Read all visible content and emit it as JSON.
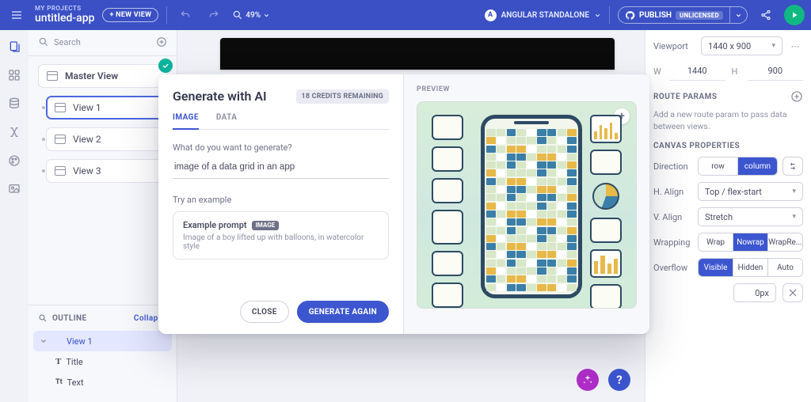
{
  "header": {
    "breadcrumb_top": "MY PROJECTS",
    "breadcrumb_title": "untitled-app",
    "new_view_btn": "+ NEW VIEW",
    "zoom_label": "49%",
    "framework_label": "ANGULAR STANDALONE",
    "publish_label": "PUBLISH",
    "license_badge": "UNLICENSED"
  },
  "left_panel": {
    "search_placeholder": "Search",
    "master_view": "Master View",
    "views": [
      "View 1",
      "View 2",
      "View 3"
    ],
    "outline_label": "OUTLINE",
    "collapse_label": "Collapse",
    "outline_tree": {
      "root": "View 1",
      "children": [
        "Title",
        "Text"
      ]
    }
  },
  "right_panel": {
    "viewport_label": "Viewport",
    "viewport_value": "1440 x 900",
    "w_label": "W",
    "w_value": "1440",
    "h_label": "H",
    "h_value": "900",
    "route_heading": "ROUTE PARAMS",
    "route_hint": "Add a new route param to pass data between views.",
    "canvas_heading": "CANVAS PROPERTIES",
    "labels": {
      "direction": "Direction",
      "h_align": "H. Align",
      "v_align": "V. Align",
      "wrapping": "Wrapping",
      "overflow": "Overflow"
    },
    "direction_opts": [
      "row",
      "column"
    ],
    "h_align_value": "Top / flex-start",
    "v_align_value": "Stretch",
    "wrapping_opts": [
      "Wrap",
      "Nowrap",
      "WrapRe..."
    ],
    "overflow_opts": [
      "Visible",
      "Hidden",
      "Auto"
    ],
    "gap_value": "0px"
  },
  "modal": {
    "title": "Generate with AI",
    "credits": "18 CREDITS REMAINING",
    "tabs": {
      "image": "IMAGE",
      "data": "DATA"
    },
    "prompt_label": "What do you want to generate?",
    "prompt_value": "image of a data grid in an app",
    "try_label": "Try an example",
    "example_title": "Example prompt",
    "example_chip": "IMAGE",
    "example_text": "Image of a boy lifted up with balloons, in watercolor style",
    "actions": {
      "close": "CLOSE",
      "generate": "GENERATE AGAIN"
    },
    "preview_label": "PREVIEW"
  },
  "fabs": {
    "help": "?"
  }
}
